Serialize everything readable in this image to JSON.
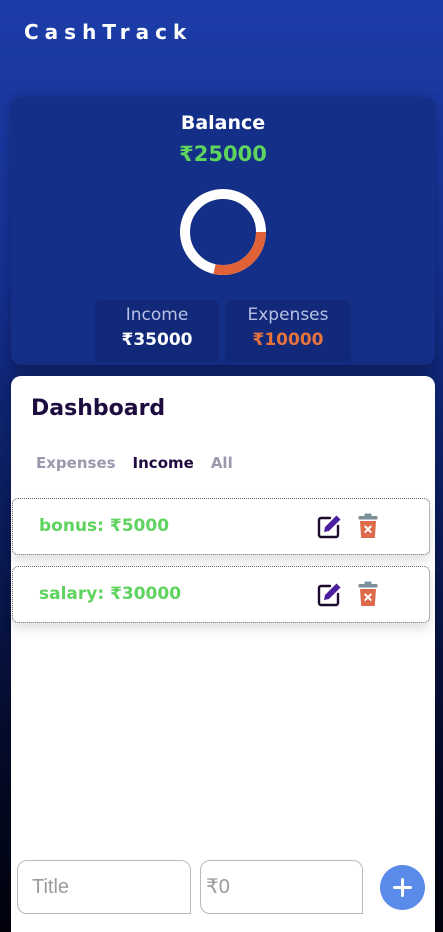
{
  "app": {
    "title": "CashTrack"
  },
  "balance": {
    "label": "Balance",
    "value": "₹25000",
    "expense_fraction": 0.2857,
    "colors": {
      "income": "#ffffff",
      "expense": "#e06236"
    }
  },
  "stats": {
    "income": {
      "label": "Income",
      "value": "₹35000"
    },
    "expenses": {
      "label": "Expenses",
      "value": "₹10000"
    }
  },
  "dashboard": {
    "title": "Dashboard",
    "tabs": [
      {
        "label": "Expenses",
        "active": false
      },
      {
        "label": "Income",
        "active": true
      },
      {
        "label": "All",
        "active": false
      }
    ],
    "entries": [
      {
        "text": "bonus: ₹5000",
        "edit_icon": "edit-icon",
        "delete_icon": "trash-icon"
      },
      {
        "text": "salary: ₹30000",
        "edit_icon": "edit-icon",
        "delete_icon": "trash-icon"
      }
    ]
  },
  "form": {
    "title_placeholder": "Title",
    "amount_placeholder": "₹0",
    "add_icon": "plus-icon"
  },
  "colors": {
    "accent_green": "#5ed35e",
    "accent_orange": "#e4743c",
    "add_button": "#5b8bea"
  }
}
